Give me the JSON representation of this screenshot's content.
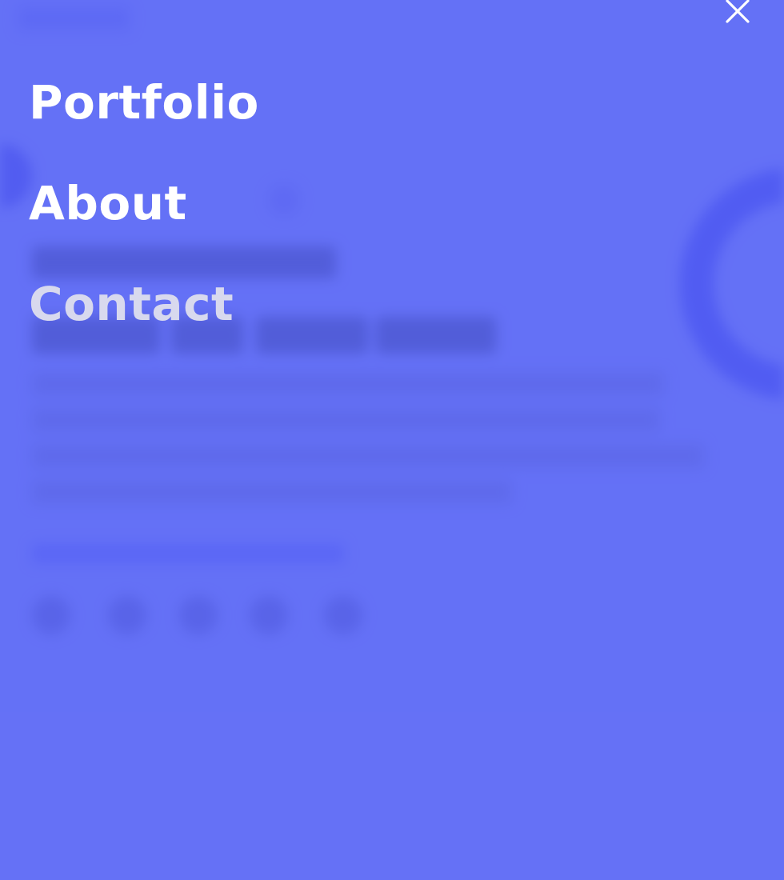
{
  "menu": {
    "items": [
      {
        "label": "Portfolio"
      },
      {
        "label": "About"
      },
      {
        "label": "Contact"
      }
    ],
    "close_icon": "close-icon"
  },
  "colors": {
    "overlay": "#6571f6",
    "menu_text": "#ffffff",
    "menu_text_active": "#d8d9ee",
    "accent": "#3a44ee"
  }
}
